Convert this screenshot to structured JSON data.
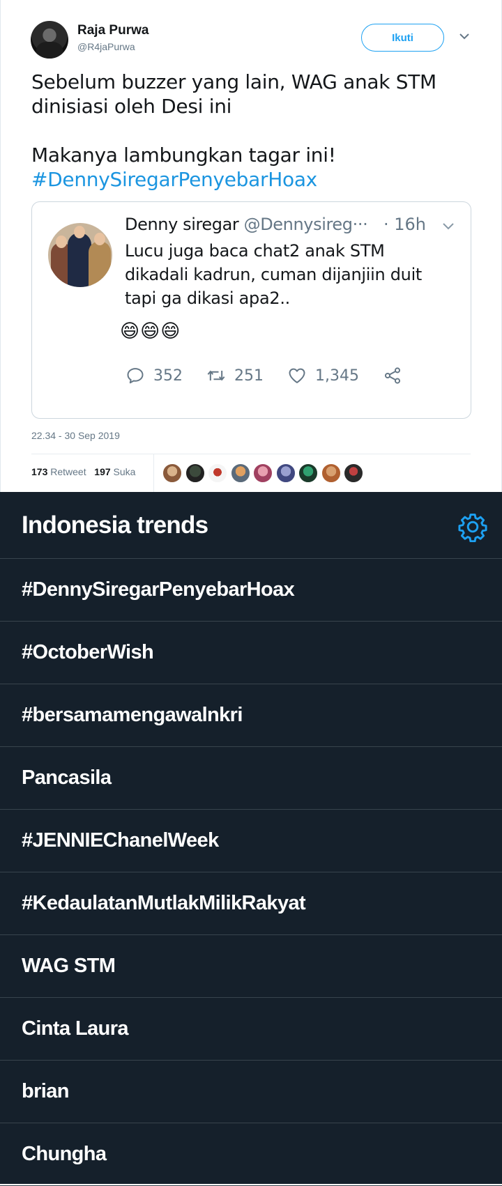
{
  "tweet": {
    "author_name": "Raja Purwa",
    "author_handle": "@R4jaPurwa",
    "follow_label": "Ikuti",
    "text_main": "Sebelum buzzer yang lain, WAG anak STM\ndinisiasi oleh Desi ini\n\nMakanya lambungkan tagar ini!",
    "hashtag": "#DennySiregarPenyebarHoax",
    "timestamp": "22.34 - 30 Sep 2019",
    "retweet_count": "173",
    "retweet_label": "Retweet",
    "like_count": "197",
    "like_label": "Suka"
  },
  "quoted": {
    "name": "Denny siregar",
    "handle": "@Dennysireg···",
    "time": "· 16h",
    "text": "Lucu juga baca chat2 anak STM\ndikadali kadrun, cuman dijanjiin duit\ntapi ga dikasi apa2..",
    "emoji": "😄😄😄",
    "replies": "352",
    "retweets": "251",
    "likes": "1,345",
    "icons": [
      "reply-icon",
      "retweet-icon",
      "heart-icon",
      "share-icon"
    ]
  },
  "trends": {
    "title": "Indonesia trends",
    "items": [
      "#DennySiregarPenyebarHoax",
      "#OctoberWish",
      "#bersamamengawalnkri",
      "Pancasila",
      "#JENNIEChanelWeek",
      "#KedaulatanMutlakMilikRakyat",
      "WAG STM",
      "Cinta Laura",
      "brian",
      "Chungha"
    ]
  },
  "colors": {
    "accent": "#1da1f2",
    "link": "#1b95e0",
    "dark_bg": "#15202b",
    "divider_dark": "#38444d",
    "muted": "#657786"
  }
}
